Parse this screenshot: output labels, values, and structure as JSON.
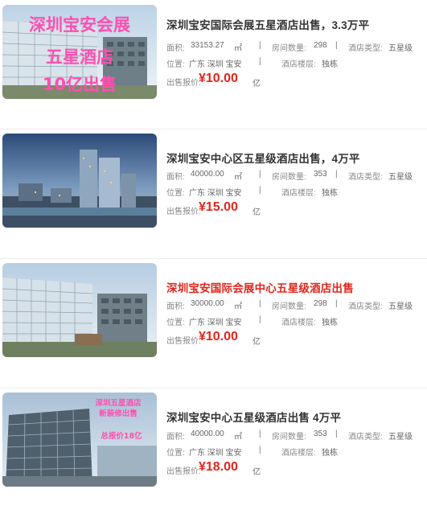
{
  "labels": {
    "area": "面积:",
    "rooms": "房间数量:",
    "hotel_type": "酒店类型:",
    "location": "位置:",
    "floors": "酒店楼层:",
    "price": "出售报价:",
    "price_unit": "亿",
    "separator": "|"
  },
  "listings": [
    {
      "title": "深圳宝安国际会展五星酒店出售，3.3万平",
      "area": "33153.27",
      "area_unit": "㎡",
      "rooms": "298",
      "hotel_type": "五星级",
      "location": "广东 深圳 宝安",
      "floors": "独栋",
      "price": "¥10.00",
      "overlay": [
        "深圳宝安会展",
        "五星酒店",
        "10亿出售"
      ],
      "highlight": false
    },
    {
      "title": "深圳宝安中心区五星级酒店出售，4万平",
      "area": "40000.00",
      "area_unit": "㎡",
      "rooms": "353",
      "hotel_type": "五星级",
      "location": "广东 深圳 宝安",
      "floors": "独栋",
      "price": "¥15.00",
      "overlay": [],
      "highlight": false
    },
    {
      "title": "深圳宝安国际会展中心五星级酒店出售",
      "area": "30000.00",
      "area_unit": "㎡",
      "rooms": "298",
      "hotel_type": "五星级",
      "location": "广东 深圳 宝安",
      "floors": "独栋",
      "price": "¥10.00",
      "overlay": [],
      "highlight": true
    },
    {
      "title": "深圳宝安中心五星级酒店出售 4万平",
      "area": "40000.00",
      "area_unit": "㎡",
      "rooms": "353",
      "hotel_type": "五星级",
      "location": "广东 深圳 宝安",
      "floors": "独栋",
      "price": "¥18.00",
      "overlay": [
        "深圳五星酒店",
        "新装修出售",
        "总报价18亿"
      ],
      "highlight": false
    }
  ],
  "colors": {
    "price_red": "#e1251b",
    "title_hot": "#e1251b",
    "overlay_pink": "#ff4fb0"
  }
}
